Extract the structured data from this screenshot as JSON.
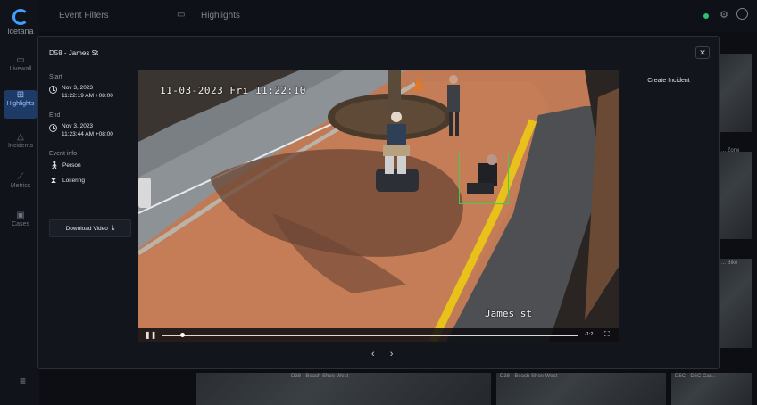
{
  "app": {
    "logo_text": "icetana"
  },
  "nav": {
    "items": [
      {
        "label": "Livewall",
        "icon": "camera-icon"
      },
      {
        "label": "Highlights",
        "icon": "grid-icon"
      },
      {
        "label": "Incidents",
        "icon": "alert-icon"
      },
      {
        "label": "Metrics",
        "icon": "chart-icon"
      },
      {
        "label": "Cases",
        "icon": "folder-icon"
      }
    ]
  },
  "topbar": {
    "filters_label": "Event Filters",
    "highlights_label": "Highlights"
  },
  "background_tiles": {
    "labels": [
      "... Zone",
      "... Bike",
      "D38 - Beach Shoe West",
      "D38 - Beach Shoe West",
      "D5C - D5C Car..."
    ]
  },
  "modal": {
    "title": "D58 - James St",
    "close_label": "✕",
    "start": {
      "label": "Start",
      "date": "Nov 3, 2023",
      "time": "11:22:19 AM +08:00"
    },
    "end": {
      "label": "End",
      "date": "Nov 3, 2023",
      "time": "11:23:44 AM +08:00"
    },
    "event_info": {
      "label": "Event info",
      "items": [
        {
          "label": "Person",
          "icon": "person-icon"
        },
        {
          "label": "Loitering",
          "icon": "hourglass-icon"
        }
      ]
    },
    "download_label": "Download Video",
    "create_incident_label": "Create Incident"
  },
  "video": {
    "osd_timestamp": "11-03-2023 Fri 11:22:10",
    "osd_camera": "James st",
    "time_remaining": "-1:2",
    "progress_fraction": 0.05
  },
  "pager": {
    "prev": "‹",
    "next": "›"
  },
  "colors": {
    "accent": "#3ea0ff",
    "detect_box": "#3bd14a",
    "status_dot": "#2fbf71"
  }
}
